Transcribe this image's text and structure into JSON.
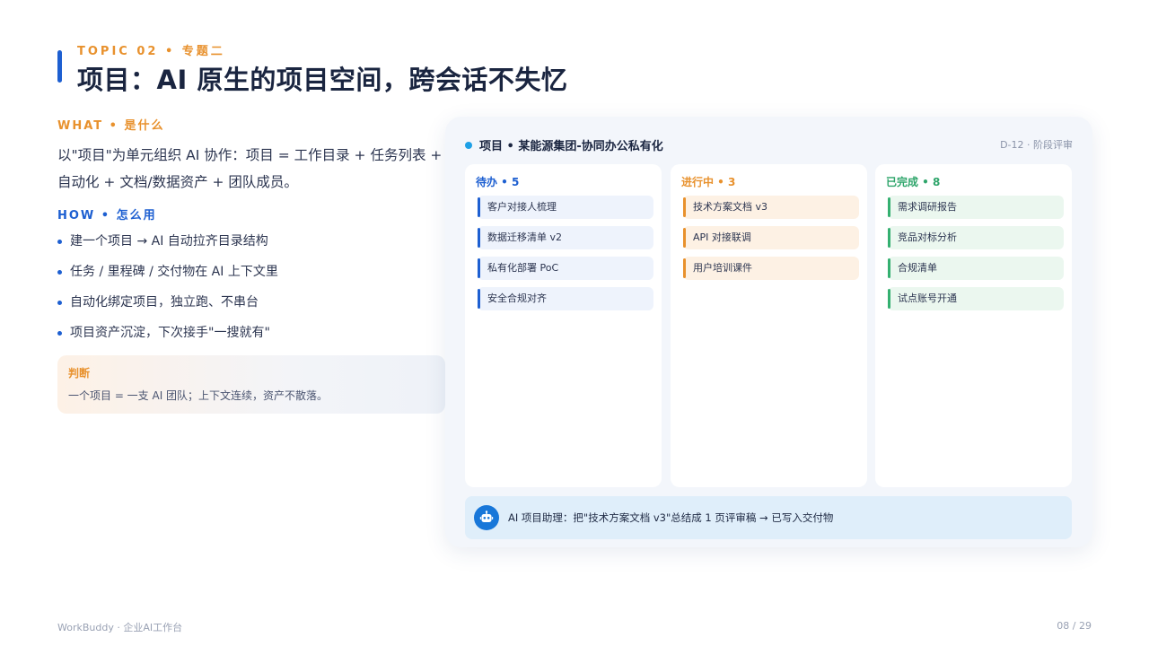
{
  "header": {
    "topic": "TOPIC 02 • 专题二",
    "title": "项目：AI 原生的项目空间，跨会话不失忆"
  },
  "what": {
    "label": "WHAT • 是什么",
    "text": "以\"项目\"为单元组织 AI 协作：项目 = 工作目录 + 任务列表 + 自动化 + 文档/数据资产 + 团队成员。"
  },
  "how": {
    "label": "HOW • 怎么用",
    "items": [
      "建一个项目 → AI 自动拉齐目录结构",
      "任务 / 里程碑 / 交付物在 AI 上下文里",
      "自动化绑定项目，独立跑、不串台",
      "项目资产沉淀，下次接手\"一搜就有\""
    ]
  },
  "judgement": {
    "title": "判断",
    "text": "一个项目 = 一支 AI 团队；上下文连续，资产不散落。"
  },
  "board": {
    "title": "项目 • 某能源集团-协同办公私有化",
    "stage": "D-12 · 阶段评审",
    "columns": [
      {
        "header": "待办 • 5",
        "cards": [
          "客户对接人梳理",
          "数据迁移清单 v2",
          "私有化部署 PoC",
          "安全合规对齐"
        ]
      },
      {
        "header": "进行中 • 3",
        "cards": [
          "技术方案文档 v3",
          "API 对接联调",
          "用户培训课件"
        ]
      },
      {
        "header": "已完成 • 8",
        "cards": [
          "需求调研报告",
          "竞品对标分析",
          "合规清单",
          "试点账号开通"
        ]
      }
    ],
    "assistant": "AI 项目助理：把\"技术方案文档 v3\"总结成 1 页评审稿 → 已写入交付物",
    "assistant_icon": "robot-icon"
  },
  "footer": {
    "brand": "WorkBuddy · 企业AI工作台",
    "page": "08 / 29"
  },
  "colors": {
    "accent_blue": "#1d5fd1",
    "accent_orange": "#e8912d",
    "accent_green": "#2fa56b"
  }
}
